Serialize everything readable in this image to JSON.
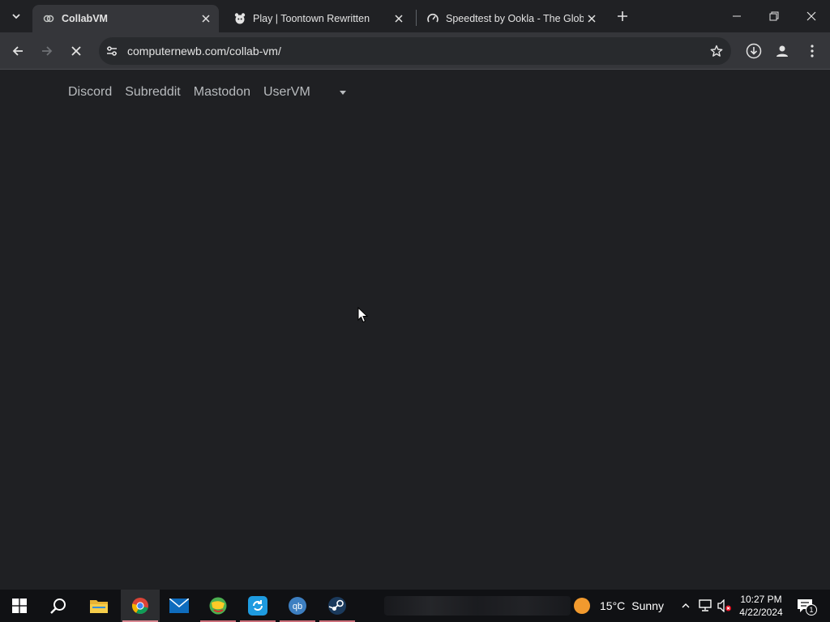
{
  "browser": {
    "tabs": [
      {
        "title": "CollabVM",
        "favicon": "collabvm-icon",
        "active": true
      },
      {
        "title": "Play | Toontown Rewritten",
        "favicon": "toontown-icon",
        "active": false
      },
      {
        "title": "Speedtest by Ookla - The Glob",
        "favicon": "speedtest-icon",
        "active": false
      }
    ],
    "url": "computernewb.com/collab-vm/"
  },
  "page": {
    "nav_links": [
      "Discord",
      "Subreddit",
      "Mastodon",
      "UserVM"
    ]
  },
  "taskbar": {
    "apps": [
      "start-icon",
      "search-icon",
      "file-explorer-icon",
      "chrome-icon",
      "mail-icon",
      "globe-app-icon",
      "refresh-app-icon",
      "qbittorrent-icon",
      "steam-icon"
    ],
    "weather": {
      "temp": "15°C",
      "condition": "Sunny"
    },
    "clock": {
      "time": "10:27 PM",
      "date": "4/22/2024"
    },
    "notification_count": "1"
  },
  "colors": {
    "background": "#1f2023",
    "tabstrip": "#202124",
    "toolbar": "#35363a",
    "taskbar": "#101114",
    "running_indicator": "#cc6f7a"
  }
}
